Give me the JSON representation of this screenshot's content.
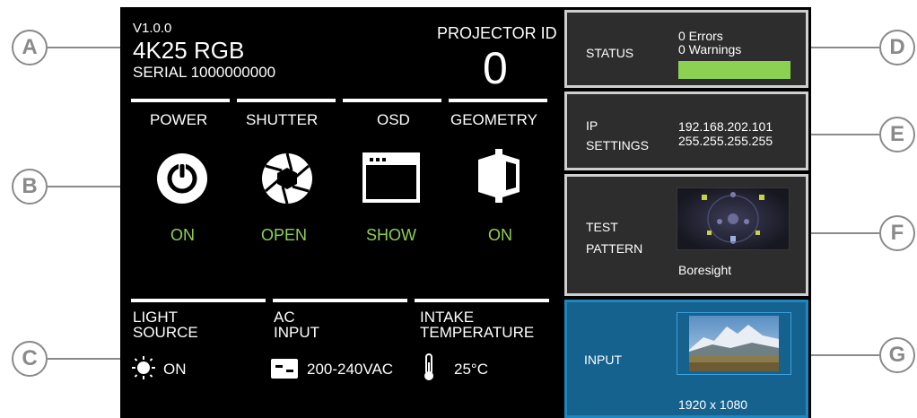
{
  "callouts": [
    "A",
    "B",
    "C",
    "D",
    "E",
    "F",
    "G"
  ],
  "header": {
    "version": "V1.0.0",
    "model": "4K25 RGB",
    "serial": "SERIAL 1000000000",
    "projector_id_label": "PROJECTOR ID",
    "projector_id_value": "0"
  },
  "controls": [
    {
      "label": "POWER",
      "state": "ON",
      "icon": "power-icon"
    },
    {
      "label": "SHUTTER",
      "state": "OPEN",
      "icon": "shutter-aperture-icon"
    },
    {
      "label": "OSD",
      "state": "SHOW",
      "icon": "osd-window-icon"
    },
    {
      "label": "GEOMETRY",
      "state": "ON",
      "icon": "geometry-icon"
    }
  ],
  "info": [
    {
      "label_line1": "LIGHT",
      "label_line2": "SOURCE",
      "value": "ON",
      "icon": "sun-icon"
    },
    {
      "label_line1": "AC",
      "label_line2": "INPUT",
      "value": "200-240VAC",
      "icon": "ac-plug-icon"
    },
    {
      "label_line1": "INTAKE",
      "label_line2": "TEMPERATURE",
      "value": "25°C",
      "icon": "thermometer-icon"
    }
  ],
  "status": {
    "label": "STATUS",
    "errors": "0 Errors",
    "warnings": "0 Warnings",
    "bar_color": "#8cd152"
  },
  "ip": {
    "label_line1": "IP",
    "label_line2": "SETTINGS",
    "address": "192.168.202.101",
    "mask": "255.255.255.255"
  },
  "test_pattern": {
    "label_line1": "TEST",
    "label_line2": "PATTERN",
    "name": "Boresight"
  },
  "input": {
    "label": "INPUT",
    "resolution": "1920 x 1080"
  },
  "colors": {
    "screen_bg": "#000000",
    "panel_bg": "#2d2d2d",
    "input_bg": "#16628e",
    "accent_green": "#8cd152",
    "callout_gray": "#8a8a8a"
  }
}
